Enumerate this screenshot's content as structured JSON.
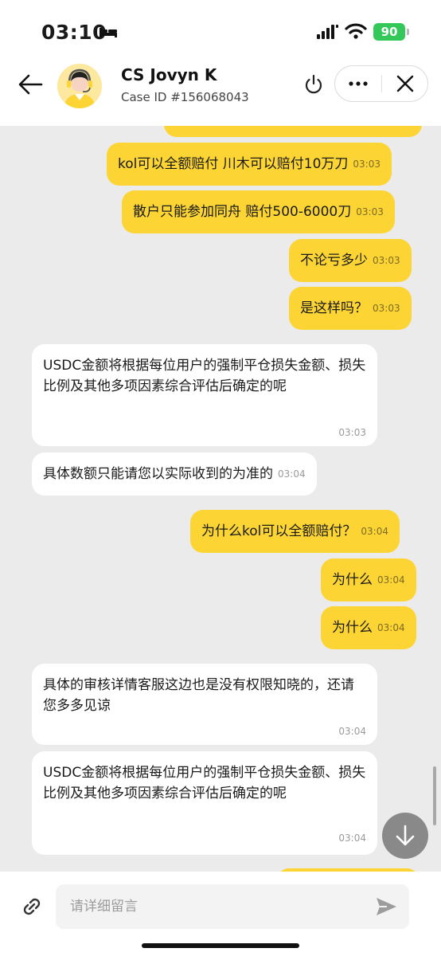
{
  "status_bar": {
    "time": "03:10",
    "battery": "90"
  },
  "header": {
    "agent_name": "CS Jovyn K",
    "case_id": "Case ID #156068043"
  },
  "messages": [
    {
      "direction": "out",
      "text": "",
      "time": ""
    },
    {
      "direction": "out",
      "text": "kol可以全额赔付 川木可以赔付10万刀",
      "time": "03:03"
    },
    {
      "direction": "out",
      "text": "散户只能参加同舟 赔付500-6000刀",
      "time": "03:03"
    },
    {
      "direction": "out",
      "text": "不论亏多少",
      "time": "03:03"
    },
    {
      "direction": "out",
      "text": "是这样吗？",
      "time": "03:03"
    },
    {
      "direction": "in",
      "text": "USDC金额将根据每位用户的强制平仓损失金额、损失比例及其他多项因素综合评估后确定的呢",
      "time": "03:03"
    },
    {
      "direction": "in",
      "text": "具体数额只能请您以实际收到的为准的",
      "time": "03:04"
    },
    {
      "direction": "out",
      "text": "为什么kol可以全额赔付？",
      "time": "03:04"
    },
    {
      "direction": "out",
      "text": "为什么",
      "time": "03:04"
    },
    {
      "direction": "out",
      "text": "为什么",
      "time": "03:04"
    },
    {
      "direction": "in",
      "text": "具体的审核详情客服这边也是没有权限知晓的，还请您多多见谅",
      "time": "03:04"
    },
    {
      "direction": "in",
      "text": "USDC金额将根据每位用户的强制平仓损失金额、损失比例及其他多项因素综合评估后确定的呢",
      "time": "03:04"
    }
  ],
  "input": {
    "placeholder": "请详细留言"
  },
  "colors": {
    "outgoing_bubble": "#fcd535",
    "incoming_bubble": "#ffffff",
    "chat_bg": "#ebebeb",
    "battery": "#34c759"
  }
}
